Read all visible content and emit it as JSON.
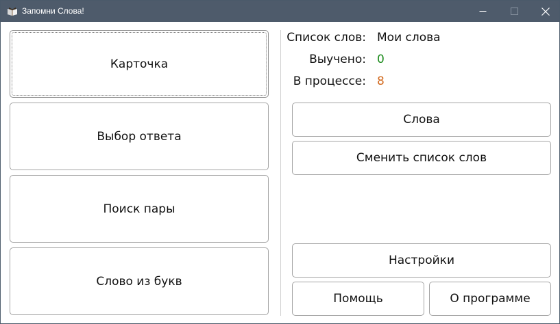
{
  "window": {
    "title": "Запомни Слова!",
    "icon": "book-icon",
    "controls": [
      "minimize-icon",
      "maximize-icon",
      "close-icon"
    ]
  },
  "modes": {
    "card": "Карточка",
    "choice": "Выбор ответа",
    "pairs": "Поиск пары",
    "letters": "Слово из букв"
  },
  "info": {
    "list_label": "Список слов:",
    "list_value": "Мои слова",
    "learned_label": "Выучено:",
    "learned_value": "0",
    "progress_label": "В процессе:",
    "progress_value": "8"
  },
  "actions": {
    "words": "Слова",
    "change_list": "Сменить список слов",
    "settings": "Настройки",
    "help": "Помощь",
    "about": "О программе"
  },
  "colors": {
    "titlebar": "#4e5b6b",
    "learned": "#1a8a1a",
    "in_progress": "#d2691e"
  }
}
